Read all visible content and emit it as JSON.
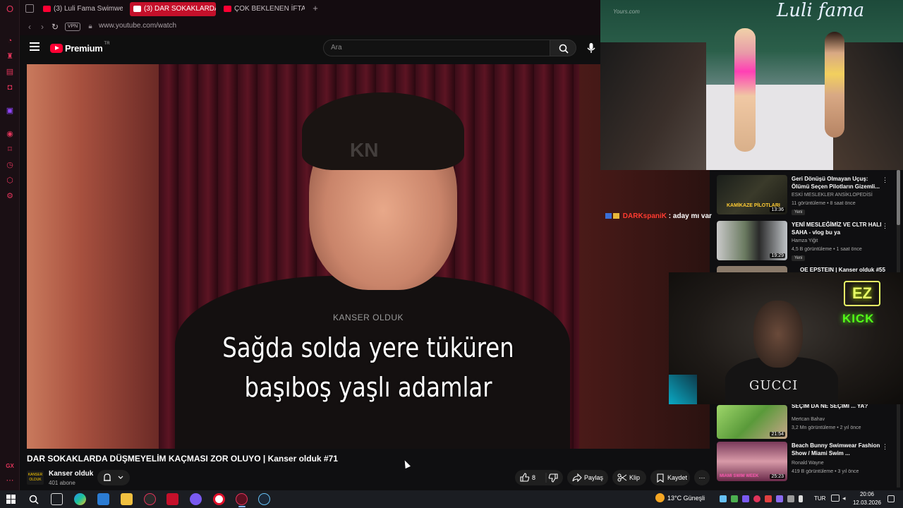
{
  "browser": {
    "tabs": [
      {
        "label": "(3) Luli Fama Swimwear Fa"
      },
      {
        "label": "(3) DAR SOKAKLARDA"
      },
      {
        "label": "ÇOK BEKLENEN İFTAR! | A"
      }
    ],
    "url": "www.youtube.com/watch",
    "vpn_label": "VPN"
  },
  "youtube": {
    "logo_text": "Premium",
    "logo_sup": "TR",
    "search_placeholder": "Ara"
  },
  "video": {
    "watermark": "KN",
    "shirt_text": "KANSER OLDUK",
    "subtitle_line1": "Sağda solda yere tüküren",
    "subtitle_line2": "başıboş yaşlı adamlar",
    "title": "DAR SOKAKLARDA DÜŞMEYELİM KAÇMASI ZOR OLUYO | Kanser olduk #71",
    "channel_avatar_text": "KANSER OLDUK",
    "channel_name": "Kanser olduk",
    "subscribers": "401 abone",
    "like_count": "8",
    "share_label": "Paylaş",
    "clip_label": "Klip",
    "save_label": "Kaydet"
  },
  "pip": {
    "brand": "Luli fama",
    "watermark": "Yours.com"
  },
  "chat": {
    "username": "DARKspaniK",
    "message": ": aday mı var"
  },
  "recommendations": [
    {
      "title": "Geri Dönüşü Olmayan Uçuş: Ölümü Seçen Pilotların Gizemli...",
      "channel": "ESKİ MESLEKLER ANSİKLOPEDİSİ",
      "meta": "11 görüntüleme • 8 saat önce",
      "badge": "Yeni",
      "duration": "13:36",
      "thumb_caption": "KAMİKAZE PİLOTLARI"
    },
    {
      "title": "YENİ MESLEĞİMİZ VE CLTR HALI SAHA - vlog bu ya",
      "channel": "Hamza Yiğit",
      "meta": "4,5 B görüntüleme • 1 saat önce",
      "badge": "Yeni",
      "duration": "19:29"
    },
    {
      "title": "OE EPSTEIN | Kanser olduk #55",
      "channel": "",
      "meta": "",
      "badge": "",
      "duration": ""
    },
    {
      "title": "SEÇİM DA NE SEÇİMİ ... YA?",
      "channel": "Mertcan Bahav",
      "meta": "3,2 Mn görüntüleme • 2 yıl önce",
      "badge": "",
      "duration": "21:54"
    },
    {
      "title": "Beach Bunny Swimwear Fashion Show / Miami Swim ...",
      "channel": "Ronald Wayne",
      "meta": "419 B görüntüleme • 3 yıl önce",
      "badge": "",
      "duration": "25:23",
      "thumb_caption": "MIAMI SWIM WEEK"
    }
  ],
  "webcam": {
    "shirt_text": "GUCCI",
    "neon_top": "EZ",
    "neon_bottom": "KICK"
  },
  "taskbar": {
    "weather": "13°C  Güneşli",
    "lang": "TUR",
    "time": "20:06",
    "date": "12.03.2026"
  },
  "sidebar": {
    "gx_label": "GX"
  },
  "colors": {
    "accent": "#c4102a",
    "youtube_red": "#ff0033",
    "neon_green": "#53fc18"
  }
}
